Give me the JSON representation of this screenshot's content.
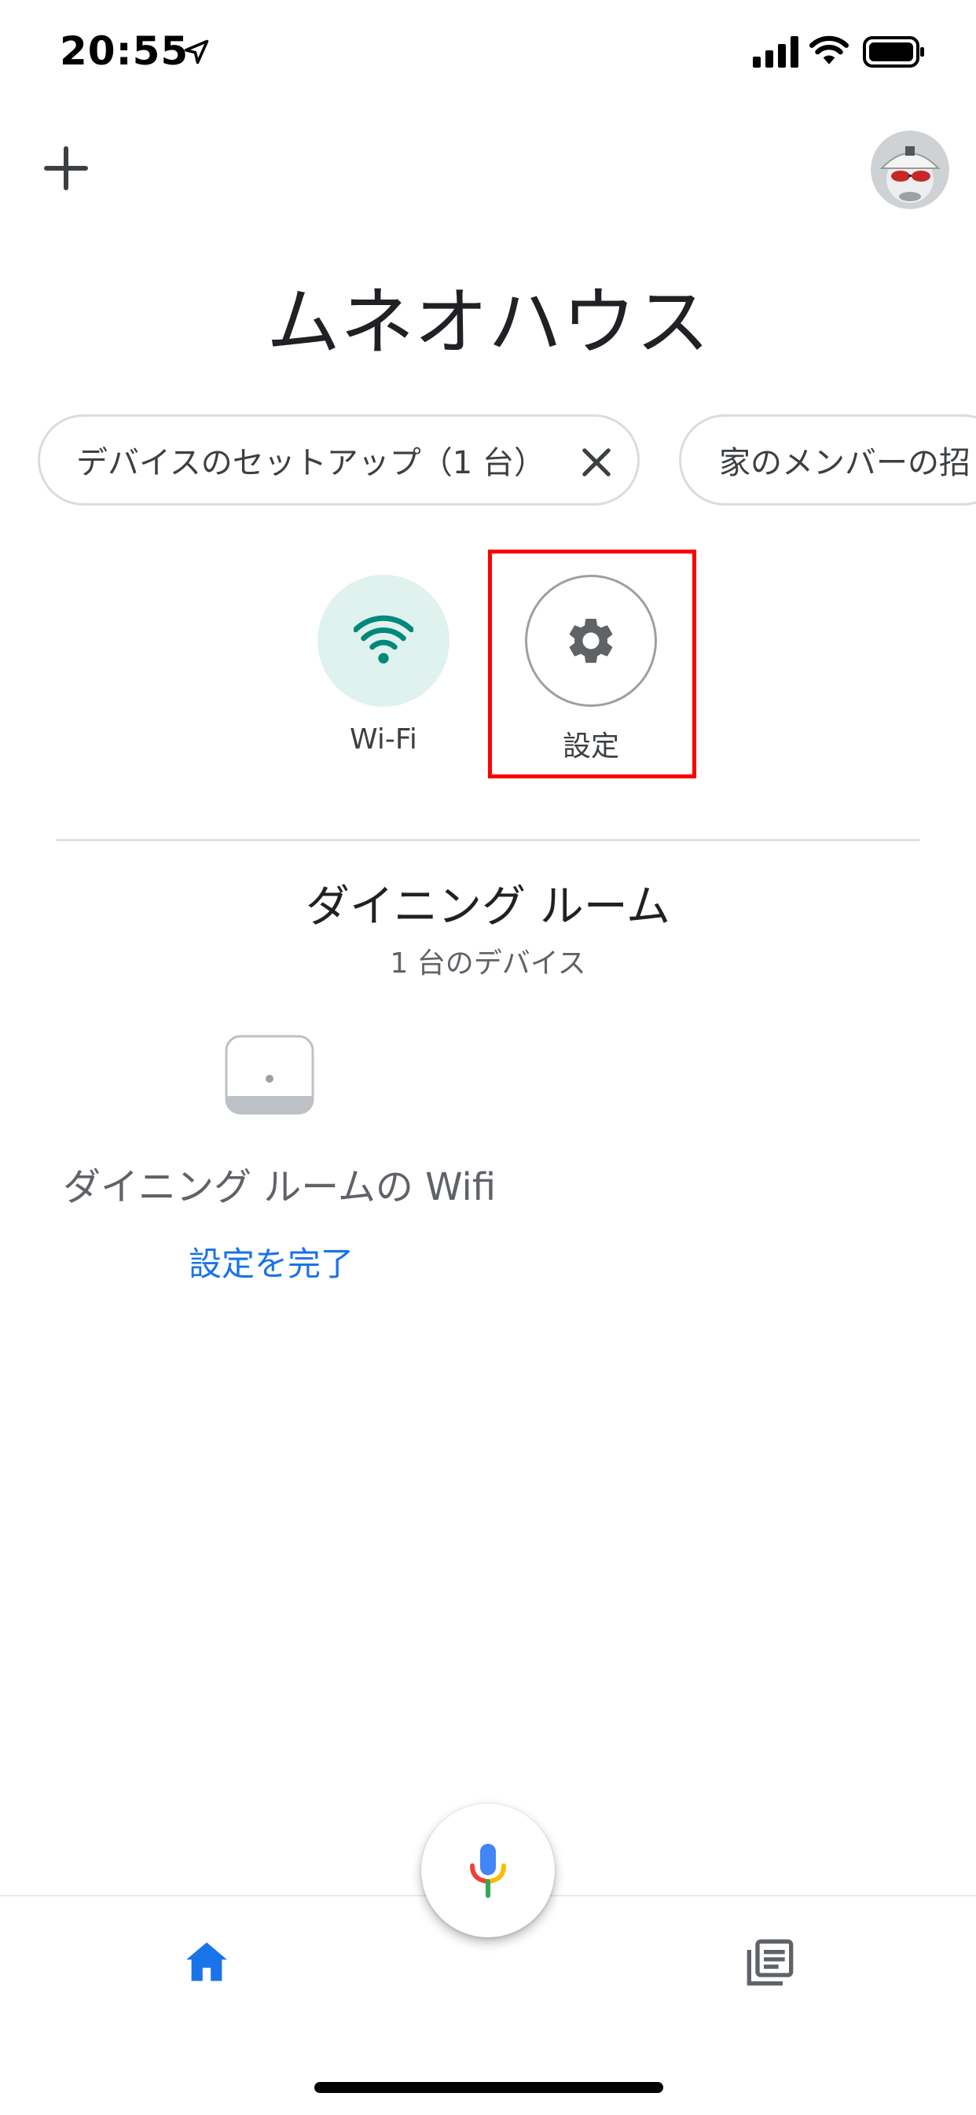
{
  "status_bar": {
    "time": "20:55"
  },
  "header": {
    "home_name": "ムネオハウス"
  },
  "chips": [
    {
      "label": "デバイスのセットアップ（1 台）"
    },
    {
      "label": "家のメンバーの招"
    }
  ],
  "quick_actions": [
    {
      "label": "Wi-Fi",
      "icon": "wifi-icon"
    },
    {
      "label": "設定",
      "icon": "gear-icon"
    }
  ],
  "room": {
    "title": "ダイニング ルーム",
    "device_count": "1 台のデバイス",
    "device": {
      "name": "ダイニング ルームの Wifi",
      "action": "設定を完了"
    }
  },
  "colors": {
    "accent": "#1a73e8",
    "wifi_green": "#00897b",
    "wifi_bg": "#e0f2ee",
    "highlight": "#ff0000"
  }
}
